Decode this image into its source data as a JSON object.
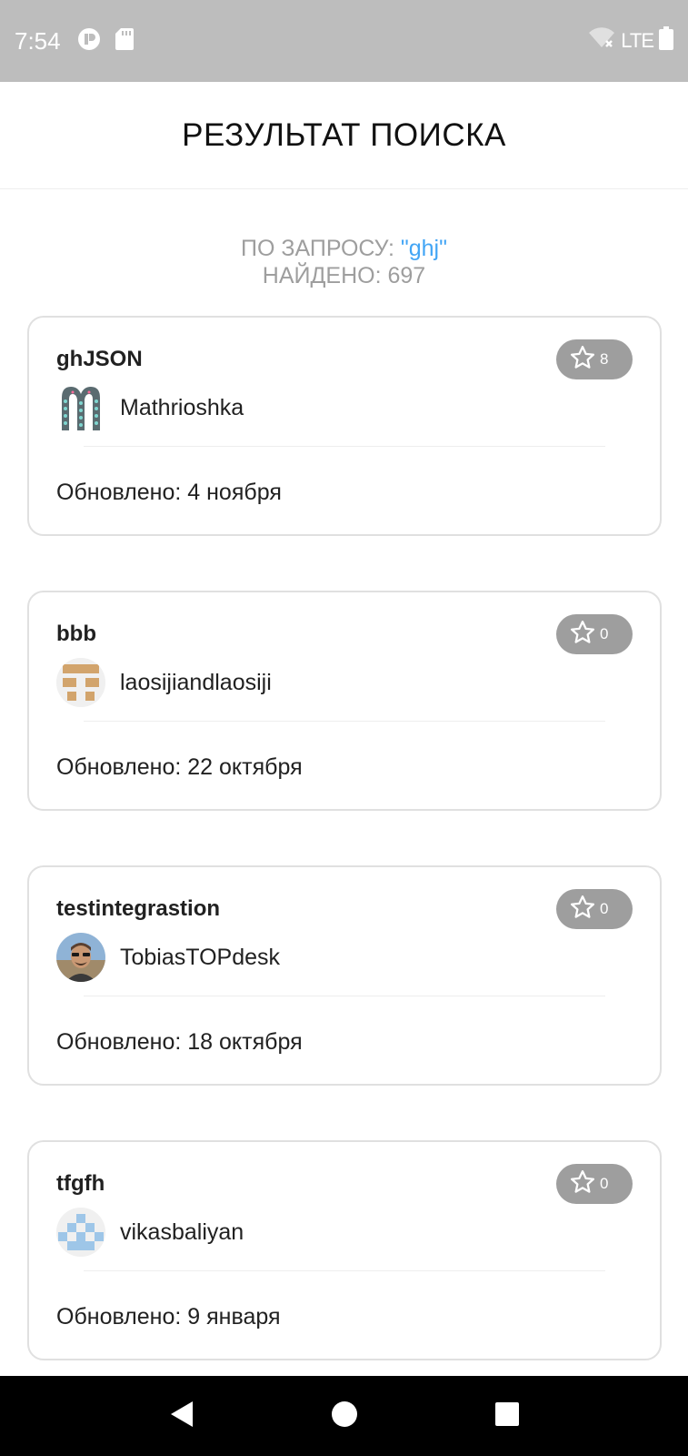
{
  "status_bar": {
    "time": "7:54",
    "network": "LTE",
    "icons": [
      "record-icon",
      "sd-card-icon",
      "wifi-off-icon",
      "battery-icon"
    ]
  },
  "app_bar": {
    "title": "РЕЗУЛЬТАТ ПОИСКА"
  },
  "summary": {
    "query_label": "ПО ЗАПРОСУ: ",
    "query_value": "\"ghj\"",
    "found_label": "НАЙДЕНО: 697"
  },
  "results": [
    {
      "name": "ghJSON",
      "stars": "8",
      "owner": "Mathrioshka",
      "updated": "Обновлено: 4 ноября",
      "avatar": "matryoshka-logo-avatar"
    },
    {
      "name": "bbb",
      "stars": "0",
      "owner": "laosijiandlaosiji",
      "updated": "Обновлено: 22 октября",
      "avatar": "identicon-tan-avatar"
    },
    {
      "name": "testintegrastion",
      "stars": "0",
      "owner": "TobiasTOPdesk",
      "updated": "Обновлено: 18 октября",
      "avatar": "photo-avatar"
    },
    {
      "name": "tfgfh",
      "stars": "0",
      "owner": "vikasbaliyan",
      "updated": "Обновлено: 9 января",
      "avatar": "identicon-blue-avatar"
    }
  ],
  "colors": {
    "status_bar": "#bdbdbd",
    "query_accent": "#42a5f5",
    "badge": "#9e9e9e",
    "card_border": "#e0e0e0"
  }
}
